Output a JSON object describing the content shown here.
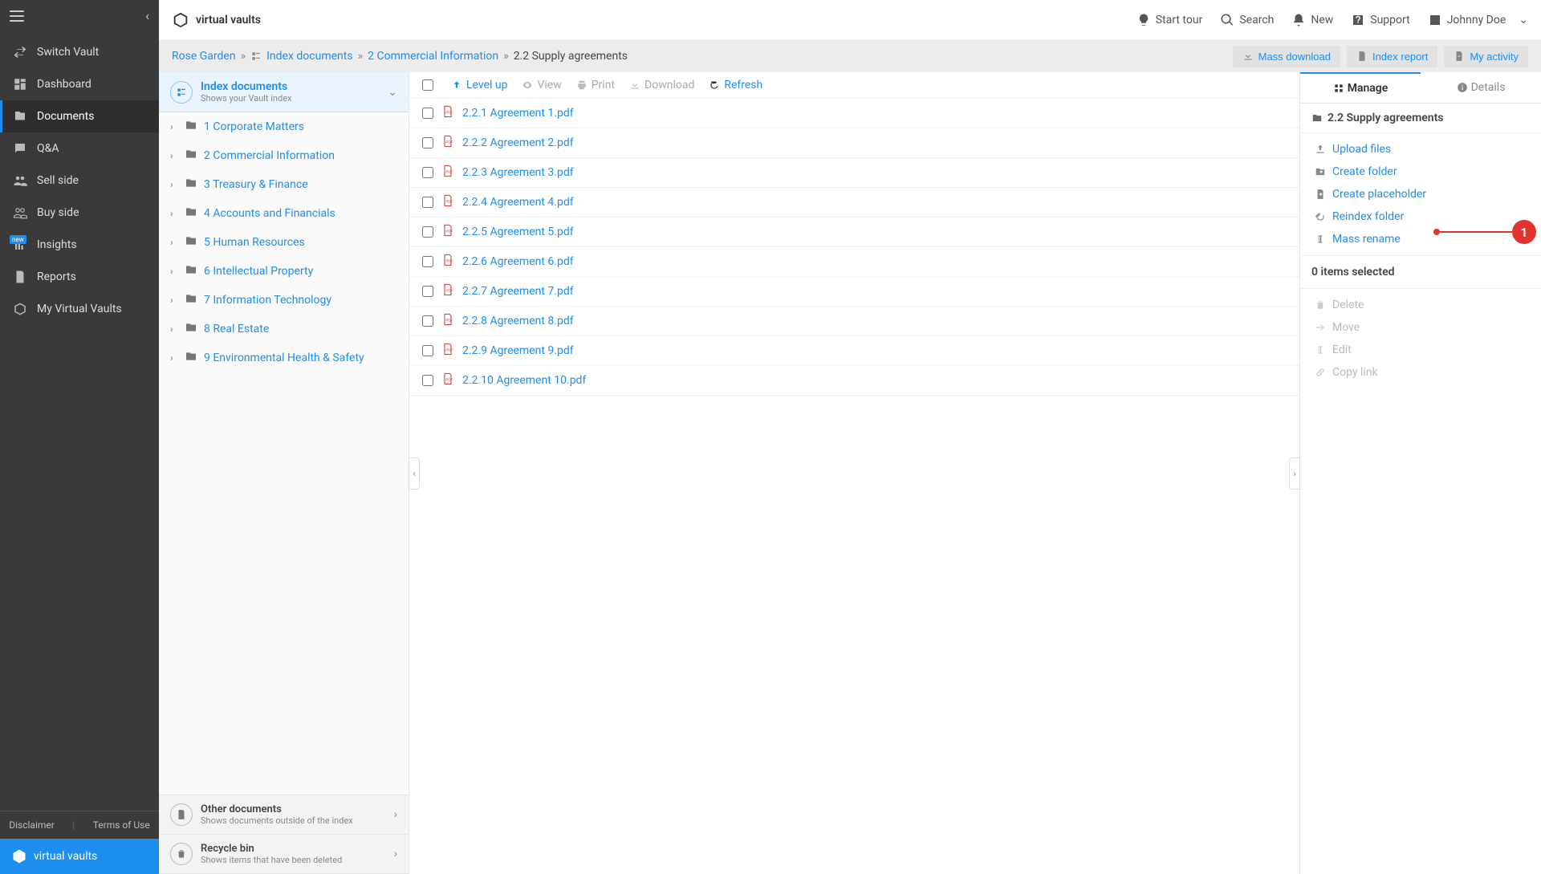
{
  "brand": "virtual vaults",
  "sidebar": {
    "items": [
      {
        "label": "Switch Vault"
      },
      {
        "label": "Dashboard"
      },
      {
        "label": "Documents"
      },
      {
        "label": "Q&A"
      },
      {
        "label": "Sell side"
      },
      {
        "label": "Buy side"
      },
      {
        "label": "Insights",
        "badge": "new"
      },
      {
        "label": "Reports"
      },
      {
        "label": "My Virtual Vaults"
      }
    ],
    "footer": {
      "disclaimer": "Disclaimer",
      "terms": "Terms of Use"
    }
  },
  "topbar": {
    "start_tour": "Start tour",
    "search": "Search",
    "new": "New",
    "support": "Support",
    "user": "Johnny Doe"
  },
  "breadcrumb": {
    "root": "Rose Garden",
    "index": "Index documents",
    "l1": "2 Commercial Information",
    "current": "2.2 Supply agreements",
    "actions": {
      "mass_download": "Mass download",
      "index_report": "Index report",
      "my_activity": "My activity"
    }
  },
  "tree": {
    "title": "Index documents",
    "subtitle": "Shows your Vault index",
    "items": [
      {
        "label": "1 Corporate Matters"
      },
      {
        "label": "2 Commercial Information"
      },
      {
        "label": "3 Treasury & Finance"
      },
      {
        "label": "4 Accounts and Financials"
      },
      {
        "label": "5 Human Resources"
      },
      {
        "label": "6 Intellectual Property"
      },
      {
        "label": "7 Information Technology"
      },
      {
        "label": "8 Real Estate"
      },
      {
        "label": "9 Environmental Health & Safety"
      }
    ],
    "other": {
      "title": "Other documents",
      "sub": "Shows documents outside of the index"
    },
    "recycle": {
      "title": "Recycle bin",
      "sub": "Shows items that have been deleted"
    }
  },
  "toolbar": {
    "level_up": "Level up",
    "view": "View",
    "print": "Print",
    "download": "Download",
    "refresh": "Refresh"
  },
  "files": [
    {
      "name": "2.2.1 Agreement 1.pdf"
    },
    {
      "name": "2.2.2 Agreement 2.pdf"
    },
    {
      "name": "2.2.3 Agreement 3.pdf"
    },
    {
      "name": "2.2.4 Agreement 4.pdf"
    },
    {
      "name": "2.2.5 Agreement 5.pdf"
    },
    {
      "name": "2.2.6 Agreement 6.pdf"
    },
    {
      "name": "2.2.7 Agreement 7.pdf"
    },
    {
      "name": "2.2.8 Agreement 8.pdf"
    },
    {
      "name": "2.2.9 Agreement 9.pdf"
    },
    {
      "name": "2.2.10 Agreement 10.pdf"
    }
  ],
  "manage": {
    "tab_manage": "Manage",
    "tab_details": "Details",
    "section_title": "2.2 Supply agreements",
    "actions": {
      "upload": "Upload files",
      "create_folder": "Create folder",
      "create_placeholder": "Create placeholder",
      "reindex": "Reindex folder",
      "mass_rename": "Mass rename"
    },
    "selected_header": "0 items selected",
    "selected_actions": {
      "delete": "Delete",
      "move": "Move",
      "edit": "Edit",
      "copy": "Copy link"
    }
  },
  "callout": {
    "number": "1"
  }
}
